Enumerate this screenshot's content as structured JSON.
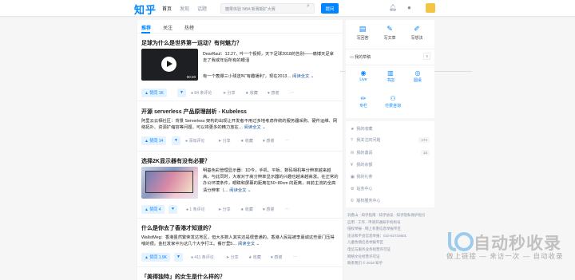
{
  "topbar": {
    "logo": "知乎",
    "nav": [
      "首页",
      "发现",
      "话题"
    ],
    "search_placeholder": "糖果体验 NBA 新赛期扩大赛",
    "ask_label": "提问"
  },
  "feed": {
    "tabs": [
      "推荐",
      "关注",
      "热榜"
    ],
    "items": [
      {
        "question": "足球为什么是世界第一运动？有何魅力？",
        "duration": "00:20",
        "excerpt": "DearRaul：12.27，叶一个视频，天下足球2018的告别——痛博天足拿去了我或年后所有的眼泪",
        "excerpt2": "有一个轰爆三小球送叫“有趣播利”，现在2013…",
        "more": "阅读全文",
        "vote": "赞同 1K",
        "comments": "84 条评论",
        "share": "分享",
        "collect": "收藏",
        "thanks": "感谢"
      },
      {
        "question": "开源 serverless 产品原理剖析 - Kubeless",
        "excerpt": "阿里云云栖社区：背景 Serverless 架构的出现让开发者不用过多地考虑传统的服务器采购、硬件运维、网络拓扑、资源扩缩容等问题，可以将更多的精力放在…",
        "more": "阅读全文",
        "vote": "赞同 14",
        "comments": "添加评论",
        "share": "分享",
        "collect": "收藏",
        "thanks": "感谢"
      },
      {
        "question": "选择2K显示器有没有必要？",
        "excerpt": "明基色彩管理显示器：1D今，手机、平板、数码相机等分辨率越来越高，与此同时，大家对于高分辨率显示器的兴趣也越来越高涨。在正常的办公环境条件，眼睛和屏幕的距离在50~80cm 的距离，目前主流的全高清分辨率（…",
        "more": "阅读全文",
        "vote": "赞同 4",
        "comments": "1 条评论",
        "share": "分享",
        "collect": "收藏",
        "thanks": "感谢"
      },
      {
        "question": "什么是你去了香港才知道的？",
        "excerpt": "WallstMeg：香港虽然繁荣发达地区，但大多数人其实还是很普通的。香港人民是被李嘉诚这些豪门压得喘的很。金杜发家中为这几个大亨打工。餐厅里5…",
        "more": "阅读全文",
        "vote": "赞同 1.9K",
        "comments": "411 条评论",
        "share": "分享",
        "collect": "收藏",
        "thanks": "感谢"
      },
      {
        "question": "「美得独特」的女生是什么样的？"
      }
    ]
  },
  "sidebar": {
    "actions": [
      "写回答",
      "写文章",
      "写想法"
    ],
    "draft_label": "我的草稿",
    "draft_count": "5",
    "tools": [
      "Live",
      "书店",
      "圆桌",
      "专栏",
      "付费咨询"
    ],
    "links": [
      {
        "label": "我的收藏",
        "count": ""
      },
      {
        "label": "我关注的问题",
        "count": "174"
      },
      {
        "label": "我的邀请",
        "count": "15"
      },
      {
        "label": "我的余额",
        "count": ""
      },
      {
        "label": "我的礼券",
        "count": ""
      },
      {
        "label": "站务中心",
        "count": ""
      },
      {
        "label": "版权服务中心",
        "count": ""
      }
    ]
  },
  "footer": [
    "刘看山 · 知乎指南 · 知乎协议 · 知乎隐私保护指引",
    "应用 · 工作 · 申请开通知乎机构号",
    "侵权举报 · 网上有害信息举报专区",
    "违法和不良信息举报：010-82716601",
    "儿童色情信息举报专区",
    "电信与服务业务经营许可证",
    "网络文化经营许可证",
    "联系我们 © 2019 知乎"
  ],
  "watermark": {
    "title": "自动秒收录",
    "subtitle": "做上链接 — 来访一次 — 自动收录"
  }
}
